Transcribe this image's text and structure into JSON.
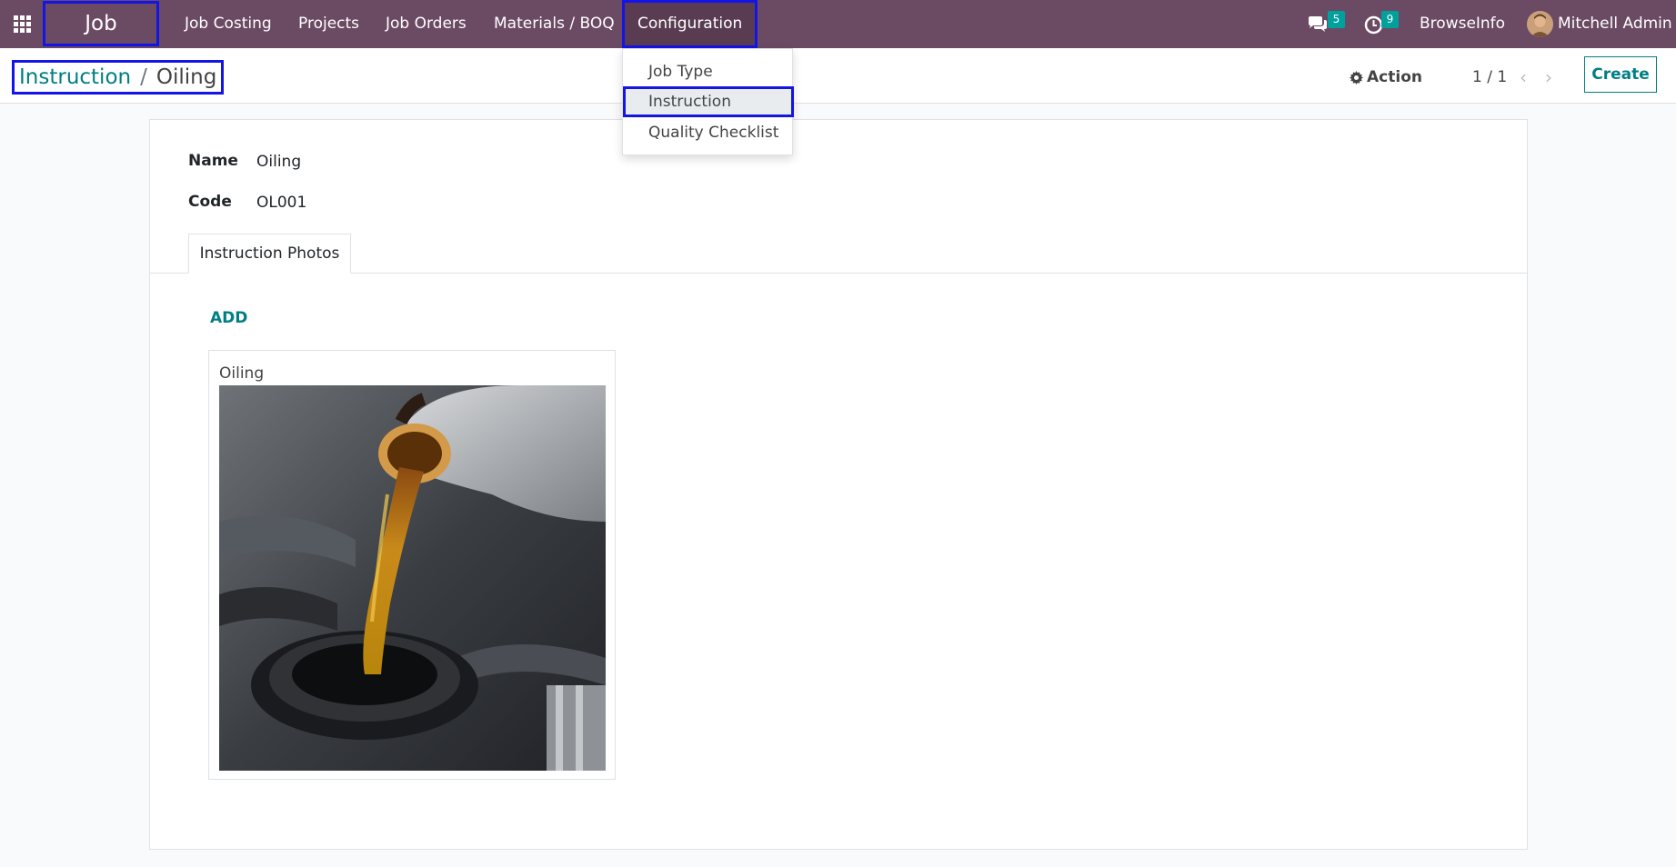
{
  "navbar": {
    "brand": "Job Costing",
    "menus": [
      "Job Costing",
      "Projects",
      "Job Orders",
      "Materials / BOQ",
      "Configuration"
    ],
    "messages_count": "5",
    "activities_count": "9",
    "company": "BrowseInfo",
    "user": "Mitchell Admin"
  },
  "dropdown": {
    "items": [
      "Job Type",
      "Instruction",
      "Quality Checklist"
    ],
    "selected": "Instruction"
  },
  "breadcrumb": {
    "parent": "Instruction",
    "separator": "/",
    "current": "Oiling"
  },
  "control": {
    "action_label": "Action",
    "pager": "1 / 1",
    "create_label": "Create"
  },
  "form": {
    "name_label": "Name",
    "name_value": "Oiling",
    "code_label": "Code",
    "code_value": "OL001",
    "tab_label": "Instruction Photos",
    "add_label": "ADD",
    "photo": {
      "title": "Oiling",
      "image": "oil-pouring-into-engine-photo"
    }
  },
  "colors": {
    "navbar": "#6b4a63",
    "accent": "#017e84",
    "badge": "#00a09d",
    "highlight": "#1414e6"
  }
}
